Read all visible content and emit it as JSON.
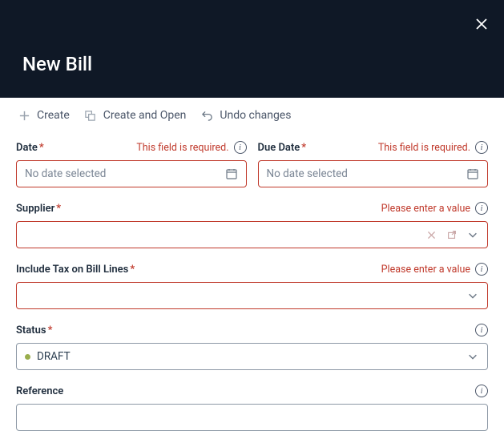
{
  "header": {
    "title": "New Bill"
  },
  "toolbar": {
    "create": "Create",
    "createOpen": "Create and Open",
    "undo": "Undo changes"
  },
  "errors": {
    "required": "This field is required.",
    "enterValue": "Please enter a value"
  },
  "fields": {
    "date": {
      "label": "Date",
      "placeholder": "No date selected"
    },
    "dueDate": {
      "label": "Due Date",
      "placeholder": "No date selected"
    },
    "supplier": {
      "label": "Supplier"
    },
    "includeTax": {
      "label": "Include Tax on Bill Lines"
    },
    "status": {
      "label": "Status",
      "value": "DRAFT"
    },
    "reference": {
      "label": "Reference"
    }
  }
}
